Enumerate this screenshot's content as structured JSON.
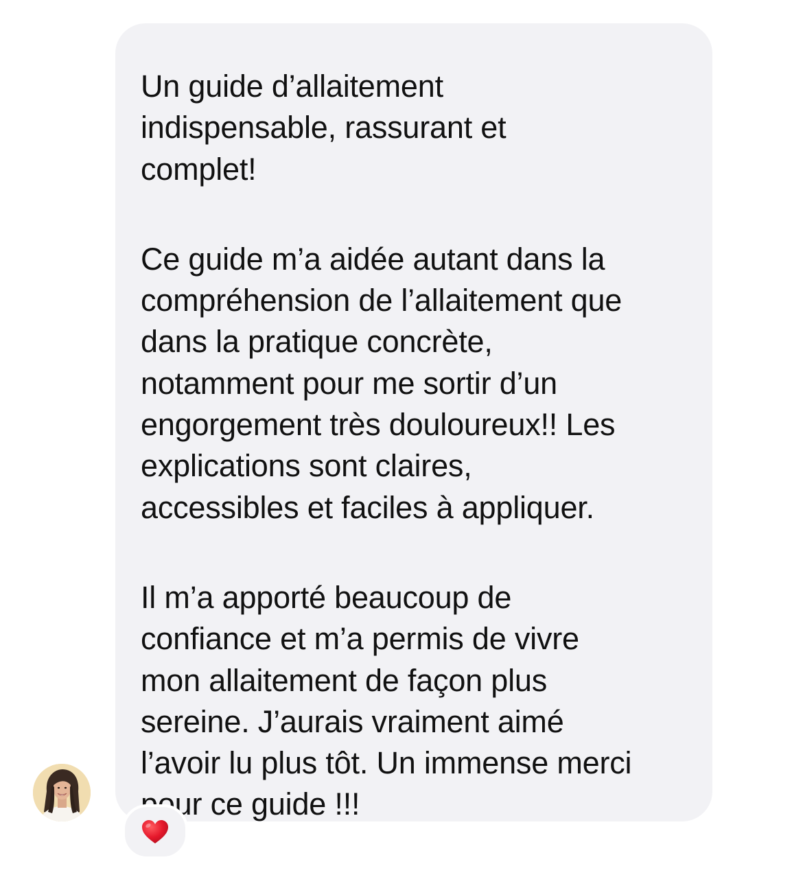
{
  "message": {
    "paragraphs": [
      "Un guide d’allaitement\nindispensable, rassurant et\ncomplet!",
      "Ce guide m’a aidée autant dans la\ncompréhension de l’allaitement que\ndans la pratique concrète,\nnotamment pour me sortir d’un\nengorgement très douloureux!! Les\nexplications sont claires,\naccessibles et faciles à appliquer.",
      "Il m’a apporté beaucoup de\nconfiance et m’a permis de vivre\nmon allaitement de façon plus\nsereine. J’aurais vraiment aimé\nl’avoir lu plus tôt. Un immense merci\npour ce guide !!!"
    ]
  },
  "sender": {
    "avatar_icon": "profile-photo-avatar"
  },
  "reaction": {
    "icon": "red-heart-icon",
    "color": "#e5182b"
  },
  "colors": {
    "bubble_background": "#f2f2f5",
    "text": "#111111",
    "page_background": "#ffffff"
  }
}
